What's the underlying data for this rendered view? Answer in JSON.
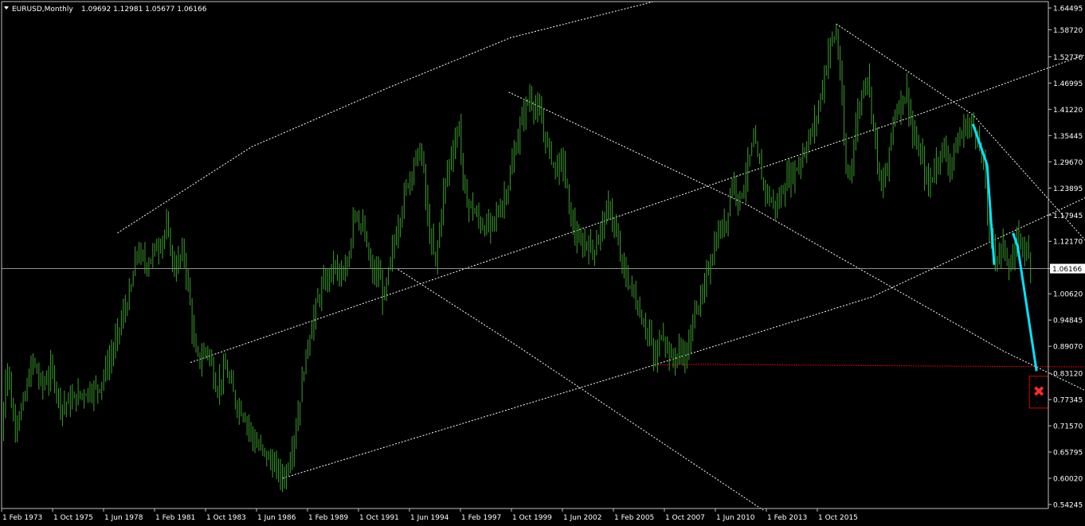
{
  "header": {
    "symbol_label": "EURUSD,Monthly",
    "ohlc_text": "1.09692 1.12981 1.05677 1.06166"
  },
  "colors": {
    "background": "#000000",
    "bars": "#3ca02c",
    "frame": "#c0c0c0",
    "channel_lines": "#ffffff",
    "projection": "#00e5ff",
    "target_line": "#d40000",
    "current_price_line": "#c0c0c0"
  },
  "chart_data": {
    "type": "ohlc",
    "title": "EURUSD,Monthly",
    "last_ohlc": {
      "open": 1.09692,
      "high": 1.12981,
      "low": 1.05677,
      "close": 1.06166
    },
    "current_price": 1.06166,
    "ylim": [
      0.54245,
      1.658
    ],
    "y_ticks": [
      "1.64495",
      "1.58720",
      "1.52770",
      "1.46995",
      "1.41220",
      "1.35445",
      "1.29670",
      "1.23895",
      "1.17945",
      "1.12170",
      "1.06166",
      "1.00620",
      "0.94845",
      "0.89070",
      "0.83120",
      "0.77345",
      "0.71570",
      "0.65795",
      "0.60020",
      "0.54245"
    ],
    "x_labels": [
      "1 Feb 1973",
      "1 Oct 1975",
      "1 Jun 1978",
      "1 Feb 1981",
      "1 Oct 1983",
      "1 Jun 1986",
      "1 Feb 1989",
      "1 Oct 1991",
      "1 Jun 1994",
      "1 Feb 1997",
      "1 Oct 1999",
      "1 Jun 2002",
      "1 Feb 2005",
      "1 Oct 2007",
      "1 Jun 2010",
      "1 Feb 2013",
      "1 Oct 2015"
    ],
    "x_range": [
      1973.08,
      2017.5
    ],
    "price_path": [
      [
        1973.08,
        0.7
      ],
      [
        1973.3,
        0.86
      ],
      [
        1973.6,
        0.72
      ],
      [
        1974.0,
        0.76
      ],
      [
        1974.4,
        0.86
      ],
      [
        1974.8,
        0.8
      ],
      [
        1975.2,
        0.84
      ],
      [
        1975.6,
        0.76
      ],
      [
        1976.0,
        0.77
      ],
      [
        1976.6,
        0.79
      ],
      [
        1977.2,
        0.8
      ],
      [
        1977.8,
        0.88
      ],
      [
        1978.3,
        0.97
      ],
      [
        1978.6,
        1.02
      ],
      [
        1978.8,
        1.1
      ],
      [
        1979.2,
        1.07
      ],
      [
        1979.8,
        1.12
      ],
      [
        1980.1,
        1.15
      ],
      [
        1980.4,
        1.06
      ],
      [
        1980.8,
        1.1
      ],
      [
        1981.0,
        1.02
      ],
      [
        1981.3,
        0.87
      ],
      [
        1981.5,
        0.86
      ],
      [
        1981.8,
        0.89
      ],
      [
        1982.2,
        0.8
      ],
      [
        1982.6,
        0.84
      ],
      [
        1983.0,
        0.77
      ],
      [
        1983.4,
        0.74
      ],
      [
        1983.8,
        0.68
      ],
      [
        1984.3,
        0.65
      ],
      [
        1984.6,
        0.63
      ],
      [
        1985.0,
        0.6
      ],
      [
        1985.2,
        0.62
      ],
      [
        1985.6,
        0.72
      ],
      [
        1985.9,
        0.84
      ],
      [
        1986.2,
        0.93
      ],
      [
        1986.6,
        1.01
      ],
      [
        1986.9,
        1.04
      ],
      [
        1987.2,
        1.07
      ],
      [
        1987.6,
        1.03
      ],
      [
        1987.9,
        1.12
      ],
      [
        1988.0,
        1.2
      ],
      [
        1988.4,
        1.15
      ],
      [
        1988.8,
        1.05
      ],
      [
        1989.1,
        1.05
      ],
      [
        1989.3,
        0.99
      ],
      [
        1989.6,
        1.08
      ],
      [
        1989.9,
        1.16
      ],
      [
        1990.3,
        1.25
      ],
      [
        1990.6,
        1.3
      ],
      [
        1990.9,
        1.32
      ],
      [
        1991.2,
        1.15
      ],
      [
        1991.5,
        1.07
      ],
      [
        1991.8,
        1.22
      ],
      [
        1992.1,
        1.3
      ],
      [
        1992.5,
        1.38
      ],
      [
        1992.7,
        1.22
      ],
      [
        1993.0,
        1.2
      ],
      [
        1993.4,
        1.16
      ],
      [
        1993.8,
        1.15
      ],
      [
        1994.2,
        1.19
      ],
      [
        1994.6,
        1.25
      ],
      [
        1994.9,
        1.33
      ],
      [
        1995.2,
        1.4
      ],
      [
        1995.5,
        1.44
      ],
      [
        1995.9,
        1.4
      ],
      [
        1996.2,
        1.34
      ],
      [
        1996.6,
        1.28
      ],
      [
        1996.9,
        1.3
      ],
      [
        1997.2,
        1.18
      ],
      [
        1997.6,
        1.11
      ],
      [
        1997.9,
        1.12
      ],
      [
        1998.2,
        1.1
      ],
      [
        1998.5,
        1.15
      ],
      [
        1998.9,
        1.2
      ],
      [
        1999.2,
        1.12
      ],
      [
        1999.5,
        1.05
      ],
      [
        1999.8,
        1.02
      ],
      [
        2000.2,
        0.96
      ],
      [
        2000.6,
        0.91
      ],
      [
        2000.8,
        0.85
      ],
      [
        2001.1,
        0.93
      ],
      [
        2001.5,
        0.86
      ],
      [
        2001.9,
        0.88
      ],
      [
        2002.2,
        0.87
      ],
      [
        2002.5,
        0.98
      ],
      [
        2002.8,
        0.99
      ],
      [
        2003.1,
        1.07
      ],
      [
        2003.5,
        1.14
      ],
      [
        2003.8,
        1.16
      ],
      [
        2004.1,
        1.26
      ],
      [
        2004.4,
        1.21
      ],
      [
        2004.8,
        1.3
      ],
      [
        2005.0,
        1.34
      ],
      [
        2005.4,
        1.25
      ],
      [
        2005.7,
        1.21
      ],
      [
        2006.0,
        1.2
      ],
      [
        2006.4,
        1.26
      ],
      [
        2006.8,
        1.28
      ],
      [
        2007.2,
        1.33
      ],
      [
        2007.6,
        1.38
      ],
      [
        2007.9,
        1.46
      ],
      [
        2008.2,
        1.55
      ],
      [
        2008.5,
        1.58
      ],
      [
        2008.7,
        1.47
      ],
      [
        2008.9,
        1.27
      ],
      [
        2009.1,
        1.28
      ],
      [
        2009.4,
        1.4
      ],
      [
        2009.8,
        1.5
      ],
      [
        2010.1,
        1.37
      ],
      [
        2010.4,
        1.23
      ],
      [
        2010.7,
        1.29
      ],
      [
        2010.9,
        1.39
      ],
      [
        2011.2,
        1.43
      ],
      [
        2011.5,
        1.45
      ],
      [
        2011.8,
        1.34
      ],
      [
        2012.1,
        1.31
      ],
      [
        2012.4,
        1.24
      ],
      [
        2012.7,
        1.29
      ],
      [
        2013.0,
        1.33
      ],
      [
        2013.3,
        1.29
      ],
      [
        2013.6,
        1.33
      ],
      [
        2013.9,
        1.37
      ],
      [
        2014.2,
        1.38
      ],
      [
        2014.5,
        1.36
      ],
      [
        2014.8,
        1.26
      ],
      [
        2015.0,
        1.13
      ],
      [
        2015.3,
        1.09
      ],
      [
        2015.6,
        1.11
      ],
      [
        2015.9,
        1.06
      ],
      [
        2016.2,
        1.13
      ],
      [
        2016.5,
        1.11
      ],
      [
        2016.8,
        1.06
      ]
    ]
  },
  "overlays": {
    "channel_lines": [
      [
        [
          1978.0,
          1.14
        ],
        [
          1983.7,
          1.33
        ],
        [
          1989.5,
          1.46
        ],
        [
          1994.7,
          1.57
        ],
        [
          2000.8,
          1.65
        ]
      ],
      [
        [
          1981.1,
          0.855
        ],
        [
          1991.3,
          1.036
        ],
        [
          2001.6,
          1.218
        ],
        [
          2011.9,
          1.399
        ],
        [
          2020.0,
          1.55
        ]
      ],
      [
        [
          1985.0,
          0.6
        ],
        [
          1999.5,
          0.829
        ],
        [
          2010.0,
          0.999
        ],
        [
          2020.0,
          1.24
        ]
      ],
      [
        [
          2008.5,
          1.6
        ],
        [
          2014.3,
          1.4
        ],
        [
          2020.0,
          1.07
        ]
      ],
      [
        [
          1994.6,
          1.45
        ],
        [
          2004.8,
          1.2
        ],
        [
          2015.6,
          0.88
        ],
        [
          2022.0,
          0.72
        ]
      ],
      [
        [
          1989.9,
          1.06
        ],
        [
          1995.0,
          0.89
        ],
        [
          2000.2,
          0.71
        ],
        [
          2005.4,
          0.53
        ]
      ]
    ],
    "projection_segments": [
      [
        [
          2014.3,
          1.38
        ],
        [
          2014.9,
          1.29
        ],
        [
          2015.2,
          1.07
        ]
      ],
      [
        [
          2016.0,
          1.14
        ],
        [
          2016.2,
          1.11
        ],
        [
          2017.0,
          0.836
        ]
      ]
    ],
    "target_line": [
      [
        2000.8,
        0.85
      ],
      [
        2003.0,
        0.851
      ],
      [
        2010.0,
        0.848
      ],
      [
        2020.0,
        0.845
      ]
    ],
    "stop_marker": {
      "x": 2017.1,
      "y": 0.795,
      "symbol": "✖"
    }
  }
}
